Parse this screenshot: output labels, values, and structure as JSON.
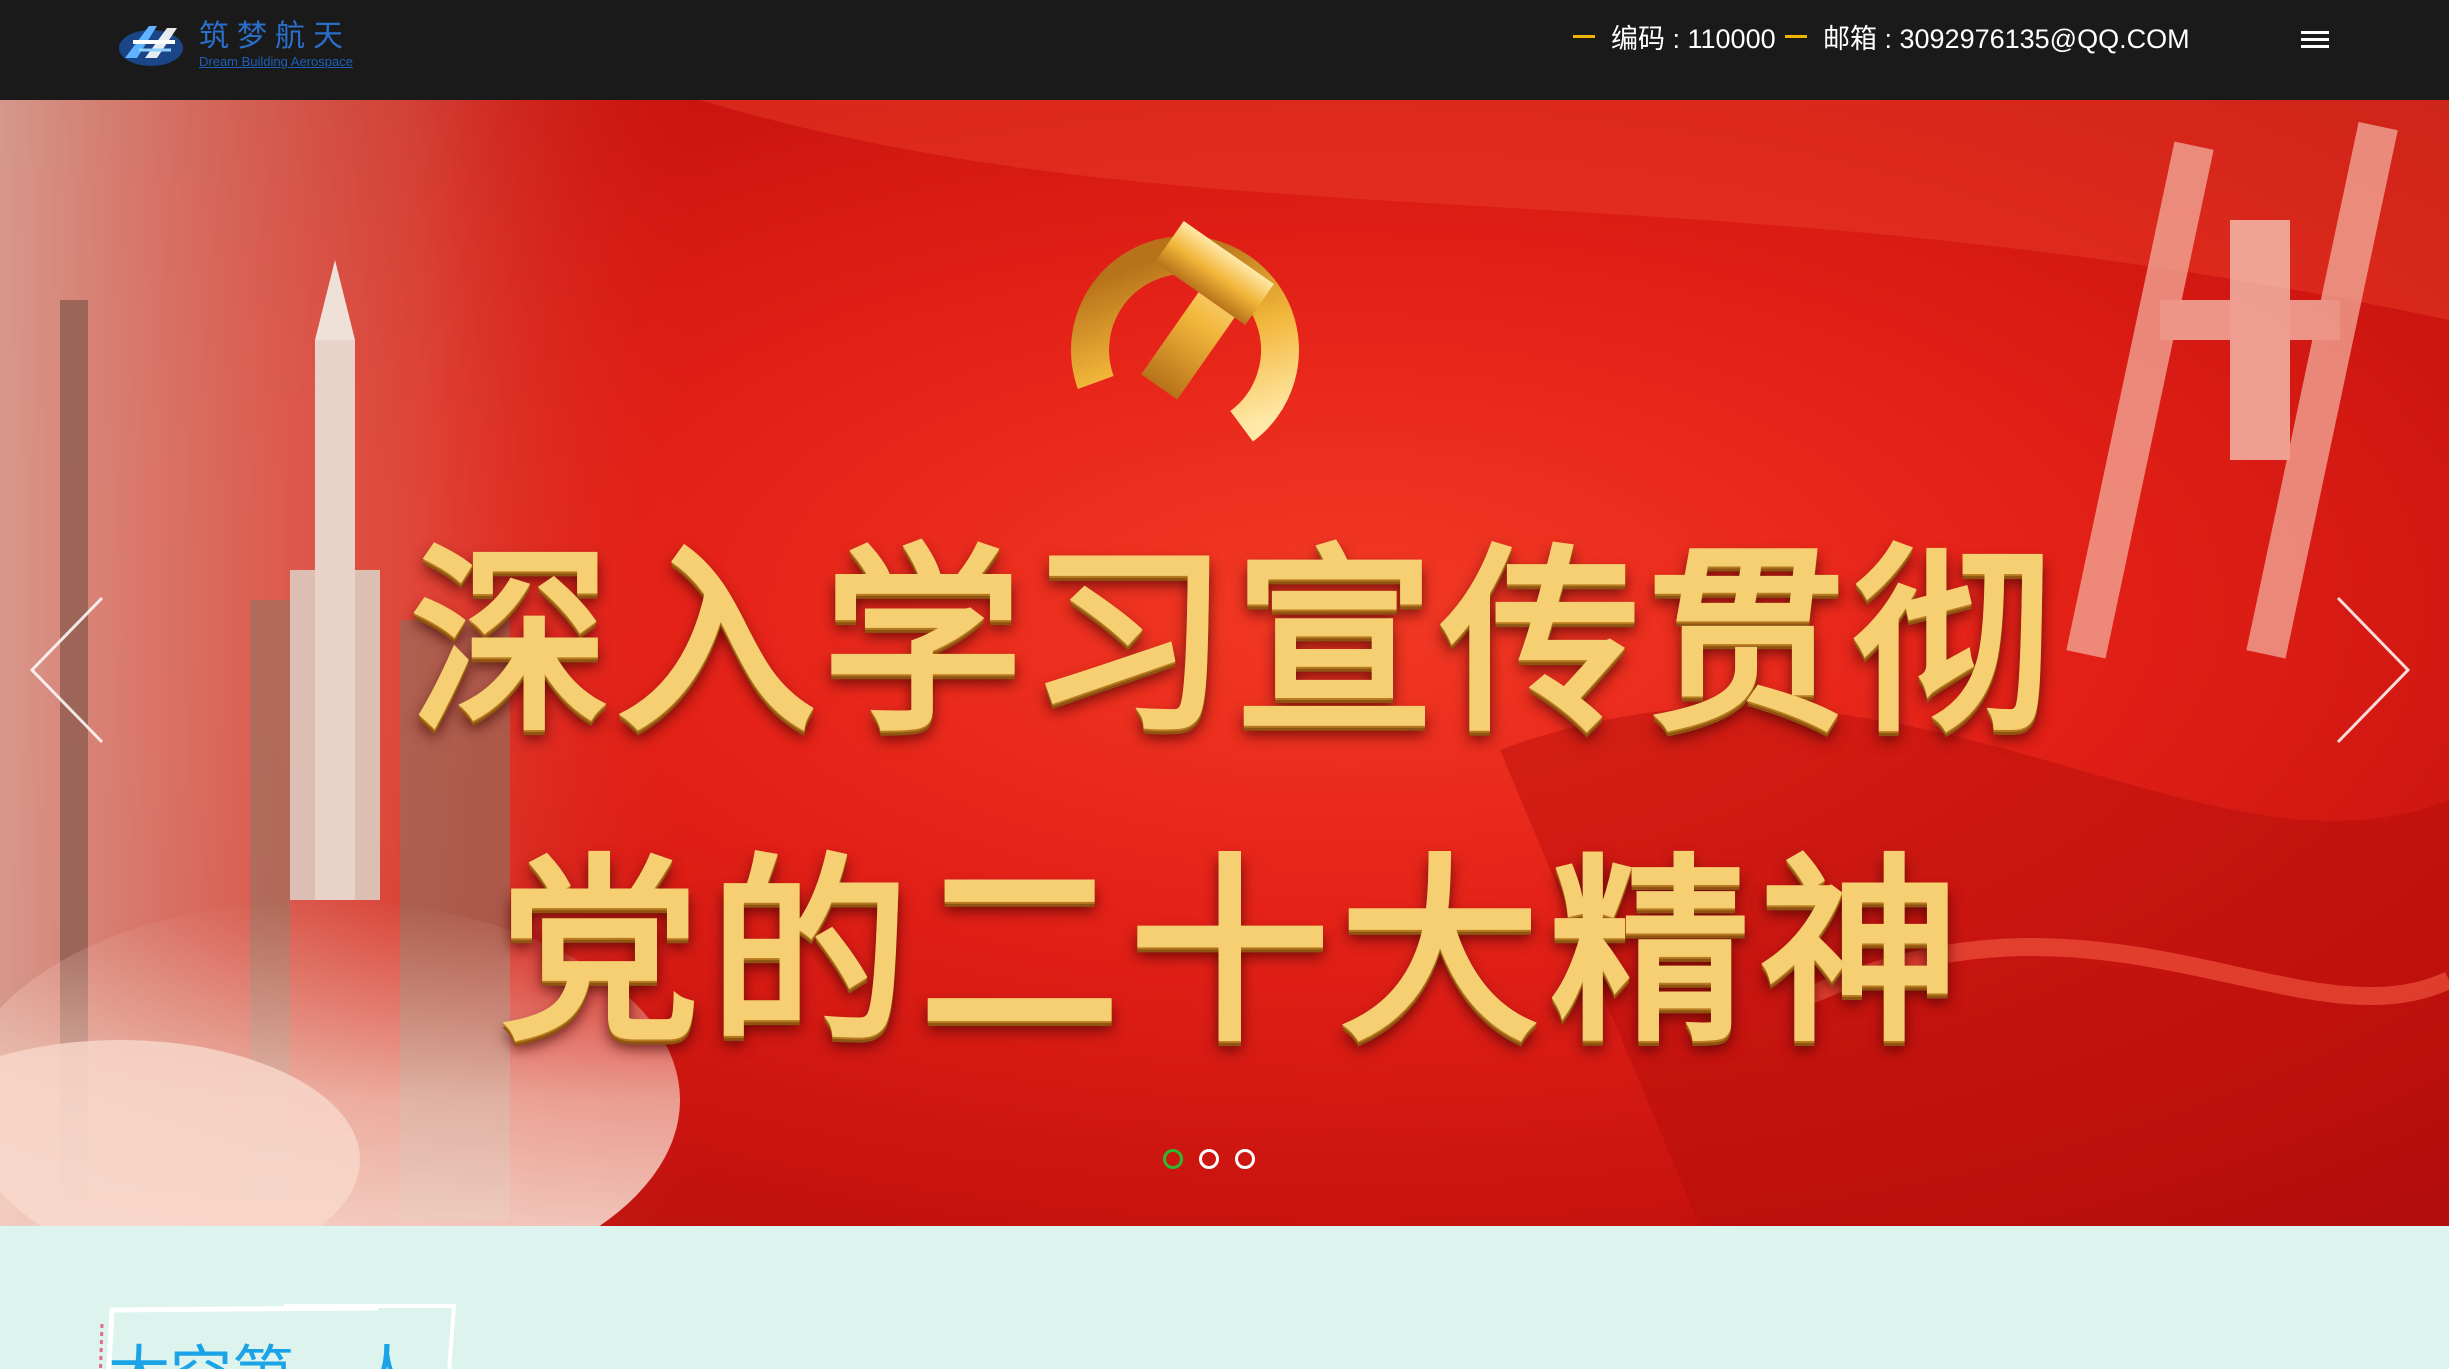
{
  "header": {
    "logo": {
      "cn_text": "筑梦航天",
      "en_text": "Dream Building Aerospace",
      "icon": "rocket-logo-icon"
    },
    "contact": {
      "code_label": "编码 : 110000",
      "email_label": "邮箱 : 3092976135@QQ.COM"
    },
    "menu_icon": "hamburger-menu-icon"
  },
  "banner": {
    "slogan_line1": "深入学习宣传贯彻",
    "slogan_line2": "党的二十大精神",
    "prev_icon": "chevron-left-icon",
    "next_icon": "chevron-right-icon",
    "slides": [
      {
        "active": true
      },
      {
        "active": false
      },
      {
        "active": false
      }
    ]
  },
  "section": {
    "title": "太空第一人"
  },
  "colors": {
    "header_bg": "#1a1a1a",
    "accent_dash": "#f0b400",
    "banner_red": "#e52218",
    "slogan_gold": "#f6cf73",
    "active_dot": "#2eb82e",
    "section_bg": "#ddf3ee",
    "section_title": "#1aa3e6",
    "logo_blue": "#2a6fc9"
  }
}
